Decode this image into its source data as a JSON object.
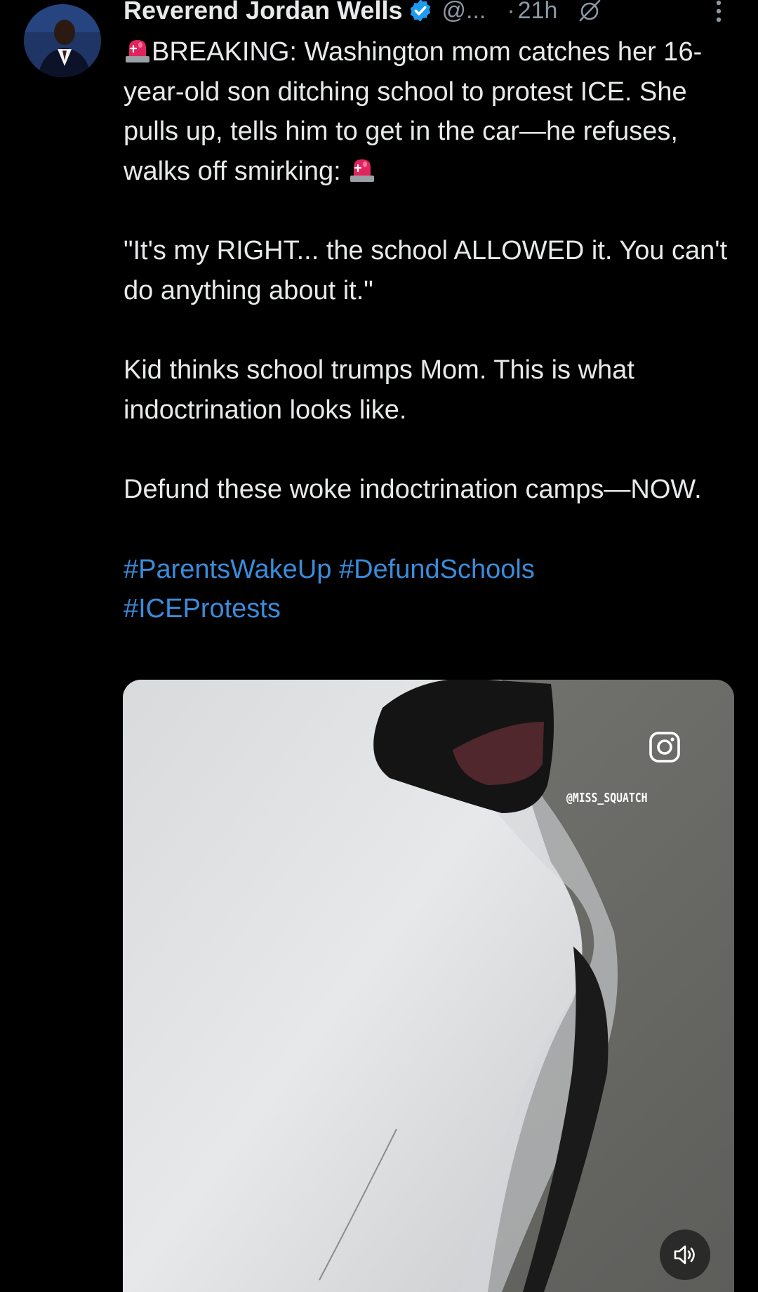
{
  "post": {
    "author": {
      "display_name": "Reverend Jordan Wells",
      "handle": "@...",
      "verified": true
    },
    "separator": "·",
    "timestamp": "21h",
    "icons": {
      "avatar": "profile-photo",
      "verified": "verified-badge-icon",
      "grok": "grok-icon",
      "more": "more-vertical-icon",
      "siren": "police-siren-emoji"
    },
    "text": {
      "p1": "BREAKING: Washington mom catches her 16-year-old son ditching school to protest ICE. She pulls up, tells him to get in the car—he refuses, walks off smirking: ",
      "p2": "\"It's my RIGHT... the school ALLOWED it. You can't do anything about it.\"",
      "p3": "Kid thinks school trumps Mom. This is what indoctrination looks like.",
      "p4": "Defund these woke indoctrination camps—NOW."
    },
    "hashtags": [
      "#ParentsWakeUp",
      "#DefundSchools",
      "#ICEProtests"
    ],
    "media": {
      "type": "video",
      "watermark": "@MISS_SQUATCH",
      "overlay_icon": "instagram-icon",
      "mute_icon": "speaker-volume-icon"
    }
  },
  "colors": {
    "background": "#000000",
    "text": "#e7e9ea",
    "secondary": "#8b98a5",
    "link": "#3a8cdb",
    "verified": "#1d9bf0"
  }
}
